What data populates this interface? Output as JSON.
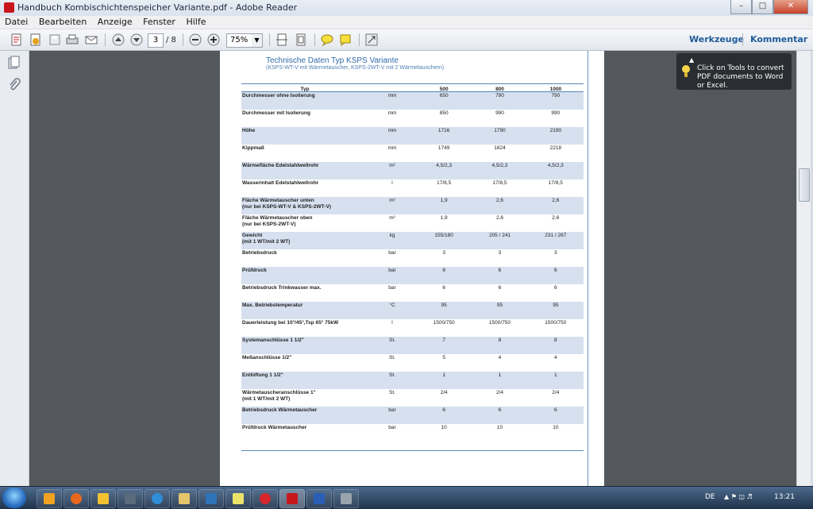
{
  "window": {
    "title": "Handbuch Kombischichtenspeicher Variante.pdf - Adobe Reader"
  },
  "menu": [
    "Datei",
    "Bearbeiten",
    "Anzeige",
    "Fenster",
    "Hilfe"
  ],
  "toolbar": {
    "current_page": "3",
    "total_pages": "/ 8",
    "zoom": "75%",
    "tools_label": "Werkzeuge",
    "comment_label": "Kommentar"
  },
  "tooltip": {
    "text": "Click on Tools to convert PDF documents to Word or Excel."
  },
  "document": {
    "title": "Technische Daten Typ KSPS Variante",
    "subtitle": "(KSPS-WT-V mit Wärmetauscher, KSPS-2WT-V mit 2 Wärmetauschern)",
    "columns": [
      "Typ",
      "",
      "500",
      "800",
      "1000"
    ],
    "rows": [
      {
        "name": "Durchmesser ohne Isolierung",
        "unit": "mm",
        "v": [
          "650",
          "790",
          "790"
        ]
      },
      {
        "name": "Durchmesser mit Isolierung",
        "unit": "mm",
        "v": [
          "850",
          "990",
          "990"
        ]
      },
      {
        "name": "Höhe",
        "unit": "mm",
        "v": [
          "1716",
          "1790",
          "2190"
        ]
      },
      {
        "name": "Kippmaß",
        "unit": "mm",
        "v": [
          "1749",
          "1824",
          "2218"
        ]
      },
      {
        "name": "Wärmefläche Edelstahlwellrohr",
        "unit": "m²",
        "v": [
          "4,5/2,3",
          "4,5/2,3",
          "4,5/2,3"
        ]
      },
      {
        "name": "Wasserinhalt Edelstahlwellrohr",
        "unit": "l",
        "v": [
          "17/8,5",
          "17/8,5",
          "17/8,5"
        ]
      },
      {
        "name": "Fläche Wärmetauscher unten\n(nur bei KSPS-WT-V & KSPS-2WT-V)",
        "unit": "m²",
        "v": [
          "1,9",
          "2,6",
          "2,6"
        ]
      },
      {
        "name": "Fläche Wärmetauscher oben\n(nur bei KSPS-2WT-V)",
        "unit": "m²",
        "v": [
          "1,9",
          "2,6",
          "2,6"
        ]
      },
      {
        "name": "Gewicht\n(mit 1 WT/mit 2 WT)",
        "unit": "kg",
        "v": [
          "155/180",
          "205 / 241",
          "231 / 267"
        ]
      },
      {
        "name": "Betriebsdruck",
        "unit": "bar",
        "v": [
          "3",
          "3",
          "3"
        ]
      },
      {
        "name": "Prüfdruck",
        "unit": "bar",
        "v": [
          "6",
          "6",
          "6"
        ]
      },
      {
        "name": "Betriebsdruck Trinkwasser max.",
        "unit": "bar",
        "v": [
          "6",
          "6",
          "6"
        ]
      },
      {
        "name": "Max. Betriebstemperatur",
        "unit": "°C",
        "v": [
          "95",
          "95",
          "95"
        ]
      },
      {
        "name": "Dauerleistung bei 10°/45°,Tsp 65° 75kW",
        "unit": "l",
        "v": [
          "1500/750",
          "1500/750",
          "1500/750"
        ]
      },
      {
        "name": "Systemanschlüsse 1 1/2\"",
        "unit": "St.",
        "v": [
          "7",
          "8",
          "8"
        ]
      },
      {
        "name": "Meßanschlüsse 1/2\"",
        "unit": "St.",
        "v": [
          "5",
          "4",
          "4"
        ]
      },
      {
        "name": "Entlüftung 1 1/2\"",
        "unit": "St.",
        "v": [
          "1",
          "1",
          "1"
        ]
      },
      {
        "name": "Wärmetauscheranschlüsse 1\"\n(mit 1 WT/mit 2 WT)",
        "unit": "St.",
        "v": [
          "2/4",
          "2/4",
          "2/4"
        ]
      },
      {
        "name": "Betriebsdruck Wärmetauscher",
        "unit": "bar",
        "v": [
          "6",
          "6",
          "6"
        ]
      },
      {
        "name": "Prüfdruck Wärmetauscher",
        "unit": "bar",
        "v": [
          "10",
          "10",
          "10"
        ]
      }
    ]
  },
  "taskbar": {
    "language": "DE",
    "clock": "13:21"
  },
  "colors": {
    "accent": "#1f5c99",
    "row_alt": "#d6e0ef",
    "doc_title": "#2f6aa8"
  }
}
